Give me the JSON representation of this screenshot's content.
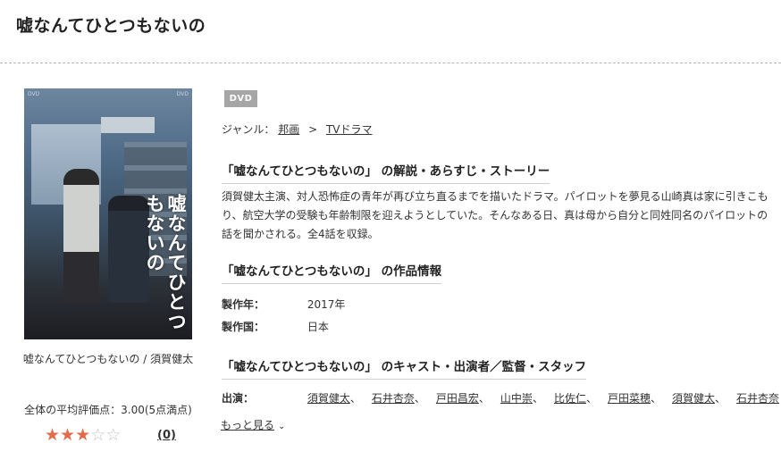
{
  "title": "嘘なんてひとつもないの",
  "poster": {
    "tag_left": "DVD",
    "tag_right": "DVD",
    "title_text": "嘘なんてひとつもないの"
  },
  "caption": "嘘なんてひとつもないの / 須賀健太",
  "rating": {
    "text": "全体の平均評価点：3.00(5点満点)",
    "value": 3,
    "max": 5,
    "review_count": "(0)"
  },
  "badge": "DVD",
  "genre": {
    "label": "ジャンル：",
    "items": [
      "邦画",
      "TVドラマ"
    ],
    "separator": ">"
  },
  "sections": {
    "synopsis_heading": "「嘘なんてひとつもないの」 の解説・あらすじ・ストーリー",
    "synopsis": "須賀健太主演、対人恐怖症の青年が再び立ち直るまでを描いたドラマ。パイロットを夢見る山崎真は家に引きこもり、航空大学の受験も年齢制限を迎えようとしていた。そんなある日、真は母から自分と同姓同名のパイロットの話を聞かされる。全4話を収録。",
    "info_heading": "「嘘なんてひとつもないの」 の作品情報",
    "info": [
      {
        "label": "製作年：",
        "value": "2017年"
      },
      {
        "label": "製作国：",
        "value": "日本"
      }
    ],
    "cast_heading": "「嘘なんてひとつもないの」 のキャスト・出演者／監督・スタッフ",
    "cast_label": "出演：",
    "cast": [
      "須賀健太",
      "石井杏奈",
      "戸田昌宏",
      "山中崇",
      "比佐仁",
      "戸田菜穂",
      "須賀健太",
      "石井杏奈"
    ],
    "more": "もっと見る"
  }
}
